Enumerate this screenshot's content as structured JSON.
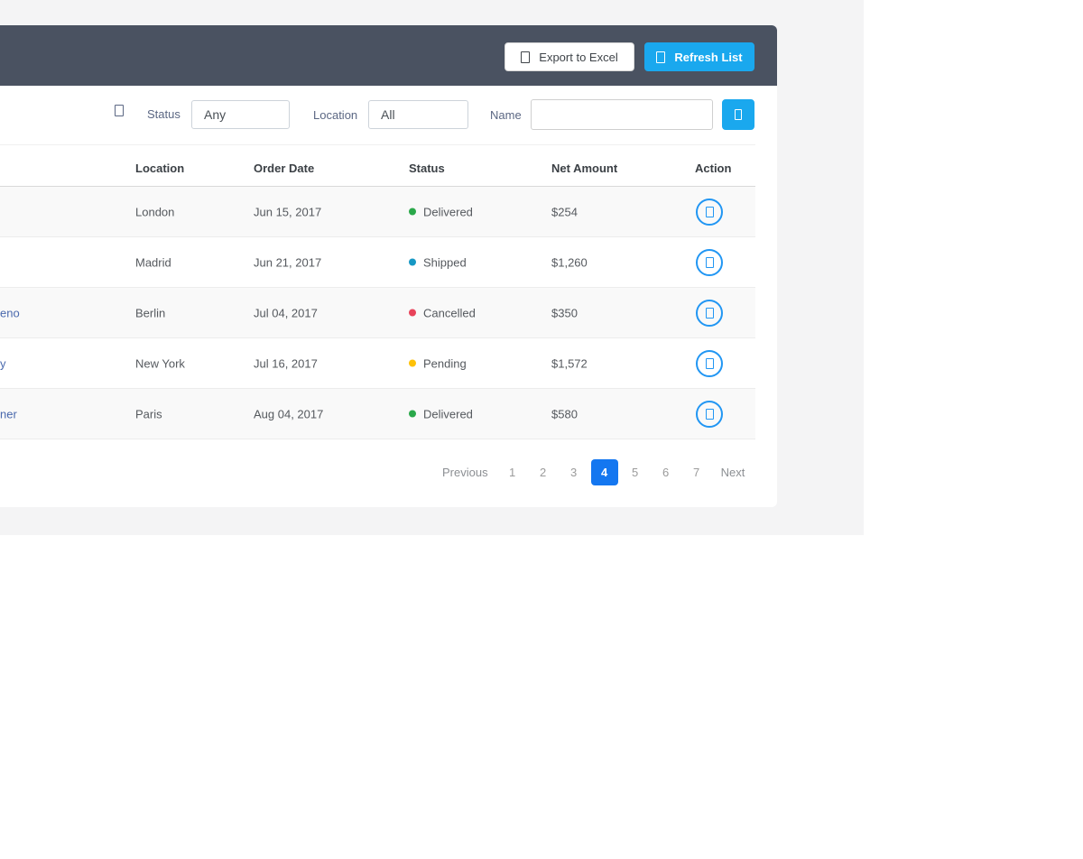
{
  "colors": {
    "page_bg": "#f4f4f5",
    "card_header_bg": "#4a5261",
    "primary_blue": "#1aa8ee",
    "pagination_active_blue": "#1477f0",
    "action_icon_blue": "#2196f3",
    "name_link_blue": "#4a69ad",
    "status_delivered": "#2aa84a",
    "status_shipped": "#1798c4",
    "status_cancelled": "#e8435a",
    "status_pending": "#fec107"
  },
  "card_header": {
    "export_label": "Export to Excel",
    "export_icon": "excel-file-icon (missing glyph box)",
    "refresh_label": "Refresh List",
    "refresh_icon": "refresh-icon (missing glyph box)"
  },
  "filters": {
    "filter_icon": "filter-icon (missing glyph box)",
    "status_label": "Status",
    "status_value": "Any",
    "location_label": "Location",
    "location_value": "All",
    "name_label": "Name",
    "name_value": "",
    "search_icon": "search-icon (missing glyph box)"
  },
  "table": {
    "columns": [
      "Location",
      "Order Date",
      "Status",
      "Net Amount",
      "Action"
    ],
    "rows": [
      {
        "name_fragment": "",
        "location": "London",
        "order_date": "Jun 15, 2017",
        "status": "Delivered",
        "status_color": "#2aa84a",
        "net_amount": "$254"
      },
      {
        "name_fragment": "",
        "location": "Madrid",
        "order_date": "Jun 21, 2017",
        "status": "Shipped",
        "status_color": "#1798c4",
        "net_amount": "$1,260"
      },
      {
        "name_fragment": "eno",
        "location": "Berlin",
        "order_date": "Jul 04, 2017",
        "status": "Cancelled",
        "status_color": "#e8435a",
        "net_amount": "$350"
      },
      {
        "name_fragment": "y",
        "location": "New York",
        "order_date": "Jul 16, 2017",
        "status": "Pending",
        "status_color": "#fec107",
        "net_amount": "$1,572"
      },
      {
        "name_fragment": "ner",
        "location": "Paris",
        "order_date": "Aug 04, 2017",
        "status": "Delivered",
        "status_color": "#2aa84a",
        "net_amount": "$580"
      }
    ],
    "action_icon": "view-details-icon (missing glyph box)"
  },
  "pagination": {
    "previous_label": "Previous",
    "pages": [
      "1",
      "2",
      "3",
      "4",
      "5",
      "6",
      "7"
    ],
    "active_page": "4",
    "next_label": "Next"
  }
}
